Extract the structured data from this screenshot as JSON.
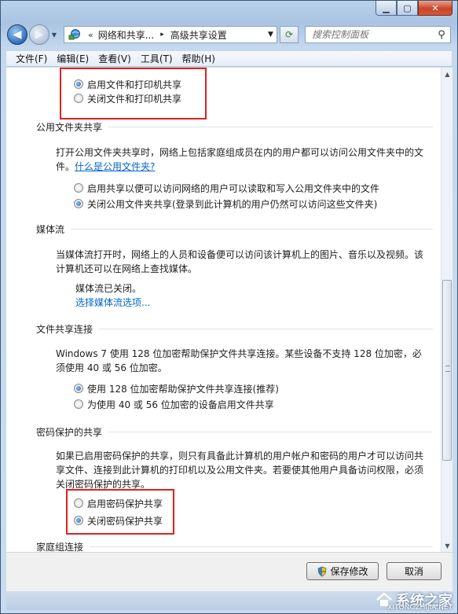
{
  "address": {
    "chevron": "«",
    "seg1": "网络和共享...",
    "arrow": "▸",
    "seg2": "高级共享设置"
  },
  "search": {
    "placeholder": "搜索控制面板"
  },
  "menu": [
    "文件(F)",
    "编辑(E)",
    "查看(V)",
    "工具(T)",
    "帮助(H)"
  ],
  "file_printer": {
    "on_label": "启用文件和打印机共享",
    "off_label": "关闭文件和打印机共享",
    "selected": "on"
  },
  "public_folder": {
    "header": "公用文件夹共享",
    "desc_line1": "打开公用文件夹共享时，网络上包括家庭组成员在内的用户都可以访问公用文件夹中的文",
    "desc_line2_prefix": "件。",
    "link": "什么是公用文件夹?",
    "on_label": "启用共享以便可以访问网络的用户可以读取和写入公用文件夹中的文件",
    "off_label": "关闭公用文件夹共享(登录到此计算机的用户仍然可以访问这些文件夹)",
    "selected": "off"
  },
  "media": {
    "header": "媒体流",
    "desc_line1": "当媒体流打开时，网络上的人员和设备便可以访问该计算机上的图片、音乐以及视频。该",
    "desc_line2": "计算机还可以在网络上查找媒体。",
    "status": "媒体流已关闭。",
    "link": "选择媒体流选项..."
  },
  "file_sharing": {
    "header": "文件共享连接",
    "desc_line1": "Windows 7 使用 128 位加密帮助保护文件共享连接。某些设备不支持 128 位加密，必",
    "desc_line2": "须使用 40 或 56 位加密。",
    "opt128": "使用 128 位加密帮助保护文件共享连接(推荐)",
    "opt40": "为使用 40 或 56 位加密的设备启用文件共享",
    "selected": "128"
  },
  "password": {
    "header": "密码保护的共享",
    "desc_line1": "如果已启用密码保护的共享，则只有具备此计算机的用户帐户和密码的用户才可以访问共",
    "desc_line2": "享文件、连接到此计算机的打印机以及公用文件夹。若要使其他用户具备访问权限，必须",
    "desc_line3": "关闭密码保护的共享。",
    "on_label": "启用密码保护共享",
    "off_label": "关闭密码保护共享",
    "selected": "off"
  },
  "homegroup": {
    "header": "家庭组连接"
  },
  "buttons": {
    "save": "保存修改",
    "cancel": "取消"
  },
  "watermark": {
    "text": "系统之家",
    "sub": "XITONGZHIJIA.NET"
  },
  "colors": {
    "highlight_box": "#e02020",
    "link": "#0066cc"
  }
}
